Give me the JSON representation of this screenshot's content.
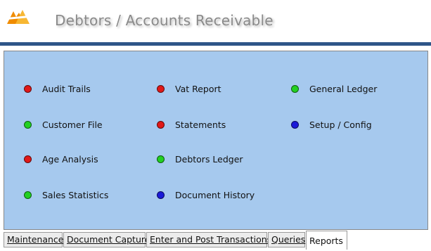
{
  "header": {
    "title": "Debtors / Accounts Receivable"
  },
  "colors": {
    "red": "#e01818",
    "green": "#22d022",
    "blue": "#1a1ad8",
    "panel": "#a6c9ee",
    "rule": "#2e5588"
  },
  "menu": {
    "items": [
      {
        "label": "Audit Trails",
        "status": "red"
      },
      {
        "label": "Customer File",
        "status": "green"
      },
      {
        "label": "Age Analysis",
        "status": "red"
      },
      {
        "label": "Sales Statistics",
        "status": "green"
      },
      {
        "label": "Vat Report",
        "status": "red"
      },
      {
        "label": "Statements",
        "status": "red"
      },
      {
        "label": "Debtors Ledger",
        "status": "green"
      },
      {
        "label": "Document History",
        "status": "blue"
      },
      {
        "label": "General Ledger",
        "status": "green"
      },
      {
        "label": "Setup / Config",
        "status": "blue"
      }
    ]
  },
  "tabs": [
    {
      "label": "Maintenance"
    },
    {
      "label": "Document Capture"
    },
    {
      "label": "Enter and Post Transactions"
    },
    {
      "label": "Queries"
    },
    {
      "label": "Reports",
      "active": true
    }
  ]
}
